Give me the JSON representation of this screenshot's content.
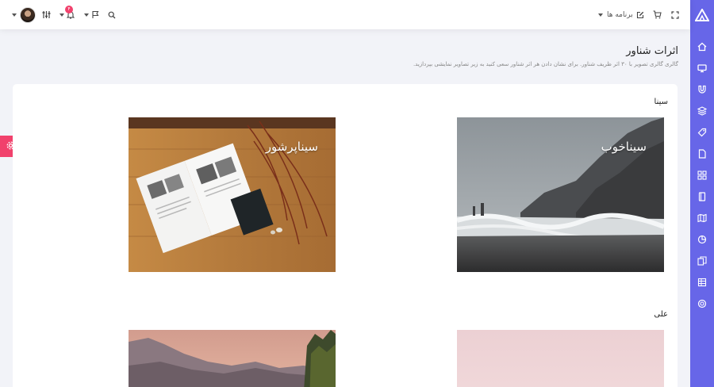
{
  "header": {
    "apps_label": "برنامه ها",
    "notification_count": "۴"
  },
  "page": {
    "title": "اثرات شناور",
    "subtitle": "گالری گالری تصویر با ۳۰ اثر ظریف شناور. برای نشان دادن هر اثر شناور سعی کنید به زیر تصاویر نمایشی بپردازید."
  },
  "gallery": {
    "sections": [
      {
        "label": "سینا",
        "items": [
          {
            "title": "سیناخوب"
          },
          {
            "title": "سیناپرشور"
          }
        ]
      },
      {
        "label": "علی"
      }
    ]
  },
  "colors": {
    "sidebar": "#6766e8",
    "accent_red": "#f1416c"
  },
  "icons": {
    "sidebar": [
      "logo-icon",
      "home-icon",
      "monitor-icon",
      "magnet-icon",
      "layers-icon",
      "tag-icon",
      "file-icon",
      "grid-icon",
      "book-icon",
      "map-icon",
      "pie-chart-icon",
      "copy-icon",
      "table-icon",
      "lifebuoy-icon"
    ],
    "header": [
      "avatar",
      "sliders-icon",
      "bell-icon",
      "flag-icon",
      "search-icon",
      "edit-icon",
      "cart-icon",
      "fullscreen-icon"
    ]
  }
}
